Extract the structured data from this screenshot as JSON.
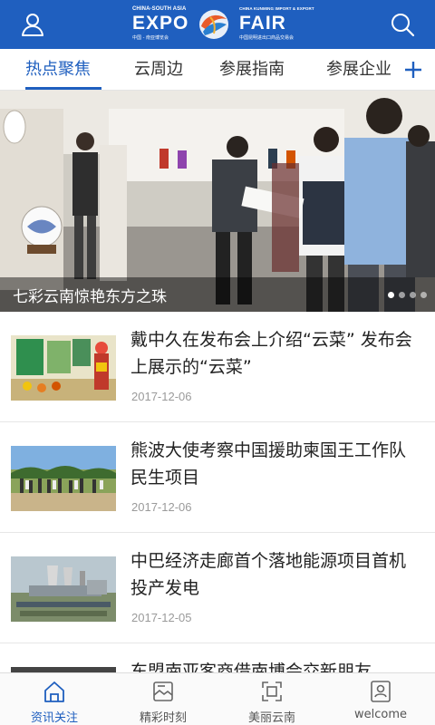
{
  "header": {
    "logo_left_top": "CHINA-SOUTH ASIA",
    "logo_left_big": "EXPO",
    "logo_left_bottom": "中国 - 南亚博览会",
    "logo_right_top": "CHINA KUNMING IMPORT & EXPORT",
    "logo_right_big": "FAIR",
    "logo_right_bottom": "中国昆明进出口商品交易会",
    "user_icon": "user-icon",
    "search_icon": "search-icon",
    "brand_color": "#1f5fbf"
  },
  "tabs": [
    {
      "label": "热点聚焦",
      "active": true
    },
    {
      "label": "云周边",
      "active": false
    },
    {
      "label": "参展指南",
      "active": false
    },
    {
      "label": "参展企业",
      "active": false
    }
  ],
  "banner": {
    "caption": "七彩云南惊艳东方之珠",
    "slide_count": 4,
    "current_slide": 1
  },
  "news": [
    {
      "title": "戴中久在发布会上介绍“云菜” 发布会上展示的“云菜”",
      "date": "2017-12-06"
    },
    {
      "title": "熊波大使考察中国援助柬国王工作队民生项目",
      "date": "2017-12-06"
    },
    {
      "title": "中巴经济走廊首个落地能源项目首机投产发电",
      "date": "2017-12-05"
    },
    {
      "title": "东盟南亚客商借南博会交新朋友",
      "date": ""
    }
  ],
  "bottom_nav": [
    {
      "label": "资讯关注",
      "icon": "home-icon",
      "active": true
    },
    {
      "label": "精彩时刻",
      "icon": "photo-icon",
      "active": false
    },
    {
      "label": "美丽云南",
      "icon": "scan-frame-icon",
      "active": false
    },
    {
      "label": "welcome",
      "icon": "profile-card-icon",
      "active": false
    }
  ]
}
